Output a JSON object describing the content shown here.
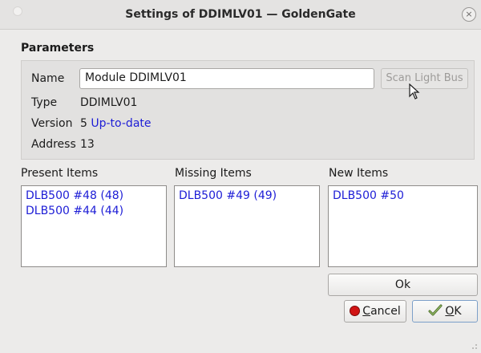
{
  "window": {
    "title": "Settings of DDIMLV01 — GoldenGate",
    "close_glyph": "×"
  },
  "parameters": {
    "section_title": "Parameters",
    "name_label": "Name",
    "name_value": "Module DDIMLV01",
    "scan_button": "Scan Light Bus",
    "scan_button_enabled": false,
    "type_label": "Type",
    "type_value": "DDIMLV01",
    "version_label": "Version",
    "version_value": "5",
    "version_status": "Up-to-date",
    "address_label": "Address",
    "address_value": "13"
  },
  "lists": {
    "present": {
      "label": "Present Items",
      "items": [
        "DLB500 #48 (48)",
        "DLB500 #44 (44)"
      ]
    },
    "missing": {
      "label": "Missing Items",
      "items": [
        "DLB500 #49 (49)"
      ]
    },
    "new": {
      "label": "New Items",
      "items": [
        "DLB500 #50"
      ]
    }
  },
  "buttons": {
    "ok_main": "Ok",
    "cancel_first": "C",
    "cancel_rest": "ancel",
    "ok_first": "O",
    "ok_rest": "K"
  },
  "colors": {
    "link": "#1d1dd6",
    "cancel_icon": "#d11414"
  },
  "icons": {
    "cancel": "red-circle-icon",
    "ok": "checkmark-icon",
    "close": "close-icon",
    "cursor": "mouse-pointer-icon"
  }
}
